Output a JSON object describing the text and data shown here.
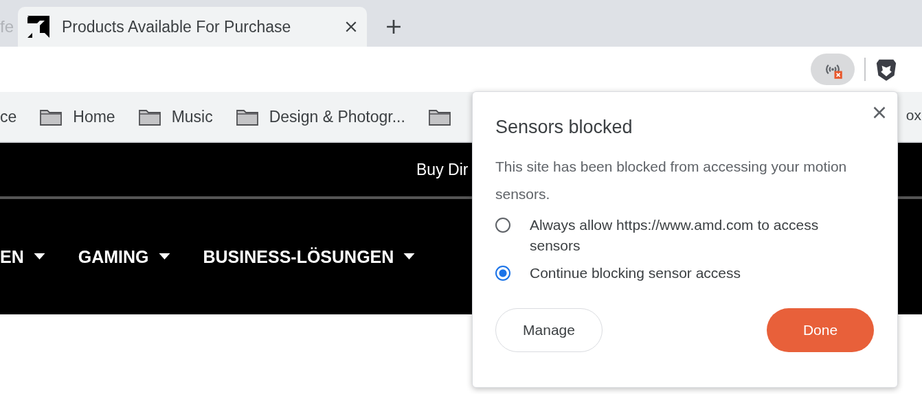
{
  "tabs": [
    {
      "title": "fe",
      "selected": false
    },
    {
      "title": "Products Available For Purchase",
      "selected": true
    }
  ],
  "bookmarks": [
    {
      "label": "ce",
      "kind": "text"
    },
    {
      "label": "Home",
      "kind": "folder"
    },
    {
      "label": "Music",
      "kind": "folder"
    },
    {
      "label": "Design & Photogr...",
      "kind": "folder"
    },
    {
      "kind": "folder"
    }
  ],
  "bookmark_right": "ox",
  "site": {
    "banner": "Buy Dir",
    "menu": [
      "EN",
      "GAMING",
      "BUSINESS-LÖSUNGEN"
    ]
  },
  "popup": {
    "title": "Sensors blocked",
    "message": "This site has been blocked from accessing your motion sensors.",
    "options": [
      {
        "label": "Always allow https://www.amd.com to access sensors",
        "selected": false
      },
      {
        "label": "Continue blocking sensor access",
        "selected": true
      }
    ],
    "manage": "Manage",
    "done": "Done"
  }
}
